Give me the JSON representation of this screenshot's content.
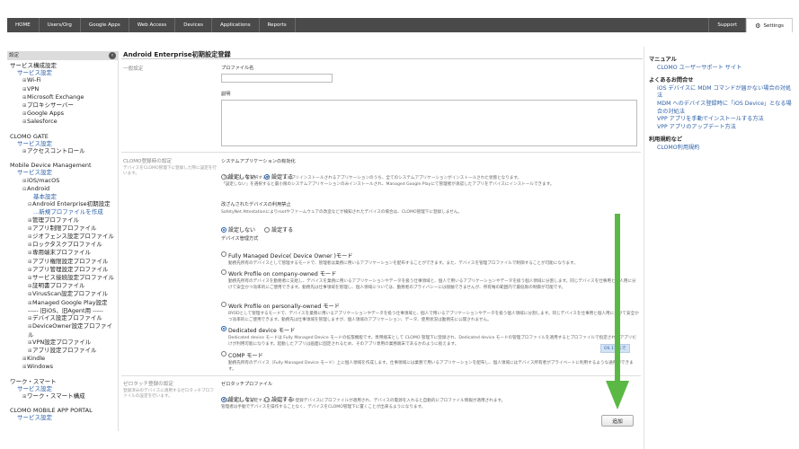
{
  "nav": {
    "items": [
      "HOME",
      "Users/Org",
      "Google Apps",
      "Web Access",
      "Devices",
      "Applications",
      "Reports"
    ],
    "support": "Support",
    "settings": "Settings"
  },
  "sidebar": {
    "head": "設定",
    "rows": [
      {
        "t": "サービス構成設定",
        "c": "sec-title"
      },
      {
        "t": "サービス設定",
        "c": "sec-link"
      },
      {
        "t": "Wi-Fi",
        "c": "tr1",
        "pm": "⊞"
      },
      {
        "t": "VPN",
        "c": "tr1",
        "pm": "⊞"
      },
      {
        "t": "Microsoft Exchange",
        "c": "tr1",
        "pm": "⊞"
      },
      {
        "t": "プロキシサーバー",
        "c": "tr1",
        "pm": "⊞"
      },
      {
        "t": "Google Apps",
        "c": "tr1",
        "pm": "⊞"
      },
      {
        "t": "Salesforce",
        "c": "tr1",
        "pm": "⊞"
      },
      {
        "t": "",
        "c": "gap"
      },
      {
        "t": "CLOMO GATE",
        "c": "sec-title"
      },
      {
        "t": "サービス設定",
        "c": "sec-link"
      },
      {
        "t": "アクセスコントロール",
        "c": "tr1",
        "pm": "⊞"
      },
      {
        "t": "",
        "c": "gap"
      },
      {
        "t": "Mobile Device Management",
        "c": "sec-title"
      },
      {
        "t": "サービス設定",
        "c": "sec-link"
      },
      {
        "t": "iOS/macOS",
        "c": "tr1",
        "pm": "⊞"
      },
      {
        "t": "Android",
        "c": "tr1",
        "pm": "⊟"
      },
      {
        "t": "基本設定",
        "c": "tr3"
      },
      {
        "t": "Android Enterprise初期設定",
        "c": "tr2",
        "pm": "⊟"
      },
      {
        "t": "...新規プロファイルを作成",
        "c": "tr3"
      },
      {
        "t": "管理プロファイル",
        "c": "tr2",
        "pm": "⊞"
      },
      {
        "t": "アプリ制限プロファイル",
        "c": "tr2",
        "pm": "⊞"
      },
      {
        "t": "ジオフェンス設定プロファイル",
        "c": "tr2",
        "pm": "⊞"
      },
      {
        "t": "ロックタスクプロファイル",
        "c": "tr2",
        "pm": "⊞"
      },
      {
        "t": "専用端末プロファイル",
        "c": "tr2",
        "pm": "⊞"
      },
      {
        "t": "アプリ権限設定プロファイル",
        "c": "tr2",
        "pm": "⊞"
      },
      {
        "t": "アプリ管理設定プロファイル",
        "c": "tr2",
        "pm": "⊞"
      },
      {
        "t": "サービス接続設定プロファイル",
        "c": "tr2",
        "pm": "⊞"
      },
      {
        "t": "証明書プロファイル",
        "c": "tr2",
        "pm": "⊞"
      },
      {
        "t": "VirusScan設定プロファイル",
        "c": "tr2",
        "pm": "⊞"
      },
      {
        "t": "Managed Google Play設定",
        "c": "tr2",
        "pm": "⊞"
      },
      {
        "t": "----- 旧iOS、旧Agent用 -----",
        "c": "tr2"
      },
      {
        "t": "デバイス設定プロファイル",
        "c": "tr2",
        "pm": "⊞"
      },
      {
        "t": "DeviceOwner設定プロファイル",
        "c": "tr2",
        "pm": "⊞"
      },
      {
        "t": "VPN設定プロファイル",
        "c": "tr2",
        "pm": "⊞"
      },
      {
        "t": "アプリ設定プロファイル",
        "c": "tr2",
        "pm": "⊞"
      },
      {
        "t": "Kindle",
        "c": "tr1",
        "pm": "⊞"
      },
      {
        "t": "Windows",
        "c": "tr1",
        "pm": "⊞"
      },
      {
        "t": "",
        "c": "gap"
      },
      {
        "t": "ワーク・スマート",
        "c": "sec-title"
      },
      {
        "t": "サービス設定",
        "c": "sec-link"
      },
      {
        "t": "ワーク・スマート構成",
        "c": "tr1",
        "pm": "⊞"
      },
      {
        "t": "",
        "c": "gap"
      },
      {
        "t": "CLOMO MOBILE APP PORTAL",
        "c": "sec-title"
      },
      {
        "t": "サービス設定",
        "c": "sec-link"
      }
    ]
  },
  "main": {
    "title": "Android Enterprise初期設定登録",
    "general": {
      "label": "一般設定",
      "profile_name_label": "プロファイル名",
      "profile_name_value": "",
      "description_label": "説明",
      "description_value": ""
    },
    "reg": {
      "label": "CLOMO登録時の設定",
      "sublabel": "デバイスをCLOMO管理下に登録した際に設定を行います。",
      "sysapp_title": "システムアプリケーションの有効化",
      "sysapp_opt1": "設定しない",
      "sysapp_opt2": "設定する",
      "sysapp_desc1": "「設定する」を選択するとデバイスにプリインストールされるアプリケーションのうち、全てのシステムアプリケーションがインストールされた状態となります。",
      "sysapp_desc2": "「設定しない」を選択すると最小限のシステムアプリケーションのみインストールされ、Managed Google Playにて管理者が承認したアプリをデバイスにインストールできます。",
      "tamper_title": "改ざんされたデバイスの利用禁止",
      "tamper_desc": "SafetyNet Attestationによりrootやファームウェアの改変などが検知されたデバイスの場合は、CLOMO管理下に登録しません。",
      "tamper_opt1": "設定しない",
      "tamper_opt2": "設定する",
      "mode_title": "デバイス管理方式",
      "modes": [
        {
          "name": "Fully Managed Device( Device Owner )モード",
          "desc": "動務先所有のデバイスとして管理するモードで、管理者は業務に用いるアプリケーションを配布することができます。また、デバイスを管理プロファイルで制御することが可能になります。"
        },
        {
          "name": "Work Profile on company-owned モード",
          "desc": "勤務先所有のデバイスを勤務者に支給し、デバイスを業務に用いるアプリケーションやデータを扱う仕事領域と、個人で用いるアプリケーションやデータを扱う個人領域に分割します。同じデバイスを仕事用と個人用に分けて安全かつ効率的にご使用できます。動務先は仕事領域を管理し、個人領域については、勤務者のプライバシーには接触できませんが、所有権の範囲内で最低限の制御が可能です。"
        },
        {
          "name": "Work Profile on personally-owned モード",
          "desc": "BYODとして管理するモードで、デバイスを業務に用いるアプリケーションやデータを扱う仕事領域と、個人で用いるアプリケーションやデータを扱う個人領域に分割します。同じデバイスを仕事用と個人用に分けて安全かつ効率的にご使用できます。動務先は仕事領域を管理しますが、個人領域のアプリケーション、データ、使用状況は勤務先に公開されません。"
        },
        {
          "name": "Dedicated device モード",
          "desc": "Dedicated device モードは Fully Managed Device モードの拡張機能です。専用端末として CLOMO 管理下に登録され、Dedicated device モードの管理プロファイルを適用するとプロファイルで指定されたアプリだけが利用可能になります。起動したアプリは画面に固定されるため、そのアプリ専用の業務端末であるかのように扱えます。"
        },
        {
          "name": "COMP モード",
          "desc": "勤務先所有のデバイス（Fully Managed Device モード）上に個人領域を作成します。仕事領域には業務で用いるアプリケーションを配布し、個人領域にはデバイス所有者がプライベートに利用するような通用ができます。"
        }
      ],
      "os_badge": "OS 11 まで"
    },
    "zt": {
      "label": "ゼロタッチ登録の設定",
      "sublabel": "登録済みのデバイスに適用するゼロタッチプロファイルの設定を行います。",
      "title": "ゼロタッチプロファイル",
      "opt1": "設定しない",
      "opt2": "設定する",
      "desc1": "「設定する」を設定すると、ゼロタッチ登録デバイスにプロファイルが適用され、デバイスの電源を入れると自動的にプロファイル情報が適用されます。",
      "desc2": "管理者は手動でデバイスを操作することなく、デバイスをCLOMO管理下に置くことが出来るようになります。"
    },
    "add_button": "追加"
  },
  "right": {
    "manual_head": "マニュアル",
    "manual_link": "CLOMO ユーザーサポート サイト",
    "faq_head": "よくあるお問合せ",
    "faq_links": [
      "iOS デバイスに MDM コマンドが届かない場合の対処法",
      "MDM へのデバイス登録時に「iOS Device」となる場合の対処法",
      "VPP アプリを手動でインストールする方法",
      "VPP アプリのアップデート方法"
    ],
    "terms_head": "利用規約など",
    "terms_link": "CLOMO利用規約"
  },
  "colors": {
    "accent": "#2b5ea7",
    "nav_bg": "#4a4a4a",
    "arrow": "#5bb845"
  },
  "icons": [
    "gear-icon",
    "collapse-icon",
    "arrow-down-icon"
  ]
}
